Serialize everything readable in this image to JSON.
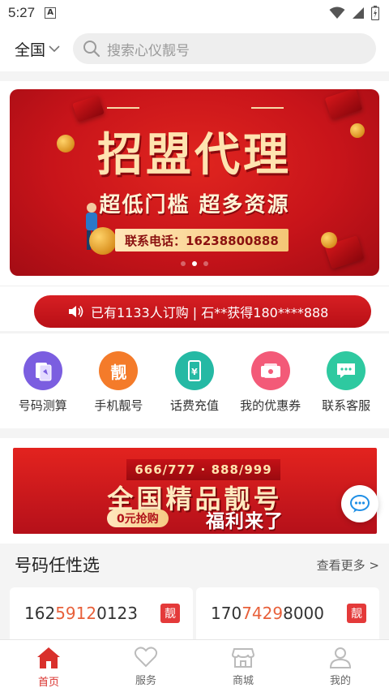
{
  "status_bar": {
    "time": "5:27",
    "badge": "A"
  },
  "header": {
    "region": "全国",
    "search_placeholder": "搜索心仪靓号"
  },
  "banner": {
    "title": "招盟代理",
    "subtitle": "超低门槛  超多资源",
    "phone": "联系电话：16238800888",
    "slides": 3,
    "active_slide": 2
  },
  "notice": {
    "text": "已有1133人订购 | 石**获得180****888"
  },
  "menu": [
    {
      "label": "号码测算",
      "icon": "calculator-card-icon",
      "color": "#7b5ee0"
    },
    {
      "label": "手机靓号",
      "icon": "liang-icon",
      "color": "#f47b2a"
    },
    {
      "label": "话费充值",
      "icon": "phone-recharge-icon",
      "color": "#25b9a4"
    },
    {
      "label": "我的优惠券",
      "icon": "coupon-icon",
      "color": "#f35a78"
    },
    {
      "label": "联系客服",
      "icon": "chat-service-icon",
      "color": "#2ec9a0"
    }
  ],
  "promo": {
    "ribbon": "666/777  ·  888/999",
    "title": "全国精品靓号",
    "button": "0元抢购",
    "slogan": "福利来了"
  },
  "section": {
    "title": "号码任性选",
    "more": "查看更多 >"
  },
  "numbers": [
    {
      "prefix": "162",
      "highlight": "5912",
      "suffix": "0123",
      "tag": "靓"
    },
    {
      "prefix": "170",
      "highlight": "7429",
      "suffix": "8000",
      "tag": "靓"
    }
  ],
  "tabs": [
    {
      "label": "首页",
      "icon": "home-icon",
      "active": true
    },
    {
      "label": "服务",
      "icon": "heart-icon",
      "active": false
    },
    {
      "label": "商城",
      "icon": "store-icon",
      "active": false
    },
    {
      "label": "我的",
      "icon": "user-icon",
      "active": false
    }
  ],
  "colors": {
    "brand_red": "#d71f23",
    "highlight_orange": "#e8603a",
    "tab_active": "#d9302c"
  }
}
